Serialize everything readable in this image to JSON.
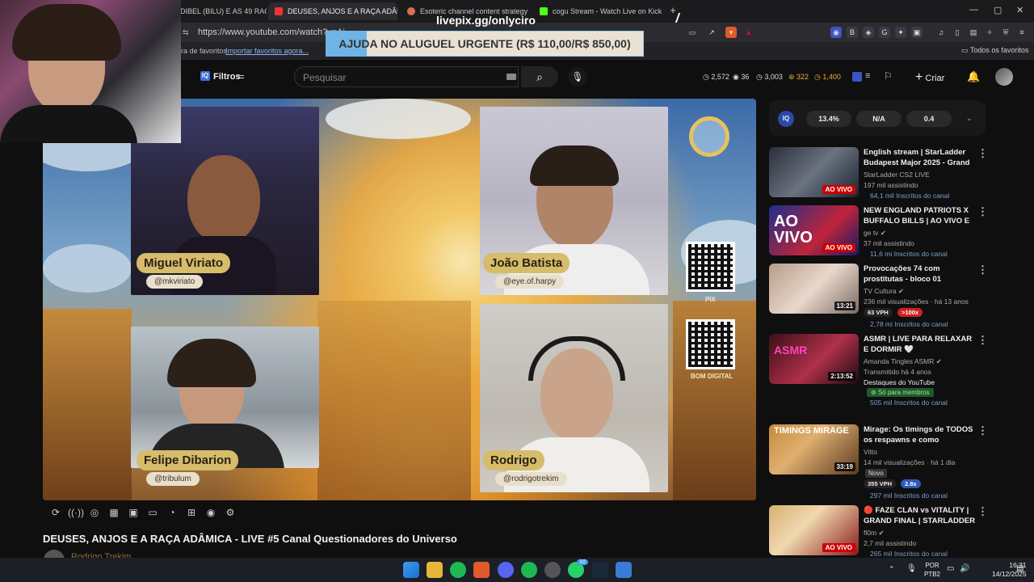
{
  "browser": {
    "tabs": [
      {
        "label": "DIBEL (BILU) E AS 49 RAÇAS"
      },
      {
        "label": "DEUSES, ANJOS E A RAÇA ADÂM"
      },
      {
        "label": "Esoteric channel content strategy - C"
      },
      {
        "label": "cogu Stream - Watch Live on Kick"
      }
    ],
    "url": "https://www.youtube.com/watch?v=Ai",
    "bookmarks_hint": "ra de favoritos.",
    "import_link": "Importar favoritos agora...",
    "all_favorites": "Todos os favoritos"
  },
  "overlay": {
    "livepix": "livepix.gg/onlyciro",
    "goal": "AJUDA NO ALUGUEL URGENTE (R$ 110,00/R$ 850,00)",
    "goal_progress": 0.129
  },
  "youtube": {
    "filters": "Filtros",
    "search_placeholder": "Pesquisar",
    "stats": [
      "2,572",
      "36",
      "3,003",
      "322",
      "1,400"
    ],
    "create": "Criar"
  },
  "video": {
    "participants": [
      {
        "name": "Miguel Viriato",
        "handle": "@mkviriato"
      },
      {
        "name": "João Batista",
        "handle": "@eye.of.harpy"
      },
      {
        "name": "Felipe Dibarion",
        "handle": "@tribulum"
      },
      {
        "name": "Rodrigo",
        "handle": "@rodrigotrekim"
      }
    ],
    "qr_labels": [
      "PIX",
      "BOM DIGITAL"
    ],
    "title": "DEUSES, ANJOS E A RAÇA ADÂMICA - LIVE #5 Canal Questionadores do Universo",
    "owner": "Rodrigo Trekim"
  },
  "iq": {
    "label": "IQ",
    "values": [
      "13.4%",
      "N/A",
      "0.4"
    ]
  },
  "recommendations": [
    {
      "title": "English stream | StarLadder Budapest Major 2025 - Grand ...",
      "channel": "StarLadder CS2 LIVE",
      "meta": "197 mil assistindo",
      "subs": "64,1 mil Inscritos do canal",
      "badge": "AO VIVO"
    },
    {
      "title": "NEW ENGLAND PATRIOTS X BUFFALO BILLS | AO VIVO E ...",
      "channel": "ge tv",
      "meta": "37 mil assistindo",
      "subs": "11,6 mi Inscritos do canal",
      "badge": "AO VIVO"
    },
    {
      "title": "Provocações 74 com prostitutas - bloco 01",
      "channel": "TV Cultura",
      "meta": "236 mil visualizações · há 13 anos",
      "vph": "63 VPH",
      "mult": ">100x",
      "subs": "2,78 mi Inscritos do canal",
      "duration": "13:21"
    },
    {
      "title": "ASMR | LIVE PARA RELAXAR E DORMIR 🤍",
      "channel": "Amanda Tingles ASMR",
      "meta": "Transmitido há 4 anos",
      "extra": "Destaques do YouTube",
      "members": "Só para membros",
      "subs": "505 mil Inscritos do canal",
      "duration": "2:13:52"
    },
    {
      "title": "Mirage: Os timings de TODOS os respawns e como aproveita...",
      "channel": "Vitto",
      "meta": "14 mil visualizações · há 1 dia",
      "extra": "Novo",
      "vph": "355 VPH",
      "mult": "2.8x",
      "subs": "297 mil Inscritos do canal",
      "duration": "33:19"
    },
    {
      "title": "🔴 FAZE CLAN vs VITALITY | GRAND FINAL | STARLADDER ...",
      "channel": "fl0m",
      "meta": "2,7 mil assistindo",
      "subs": "265 mil Inscritos do canal",
      "badge": "AO VIVO"
    }
  ],
  "taskbar": {
    "lang1": "POR",
    "lang2": "PTB2",
    "time": "16:31",
    "date": "14/12/2025",
    "notif": "10"
  },
  "colors": {
    "accent": "#cc0000",
    "badge_gold": "#d6bc6b",
    "goal_fill": "#6fb4e6"
  }
}
